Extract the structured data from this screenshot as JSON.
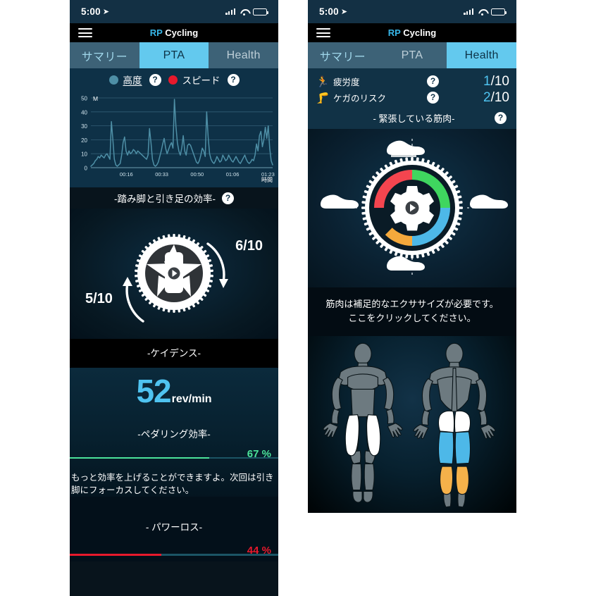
{
  "status_bar": {
    "time": "5:00",
    "location_icon": "location-arrow-icon",
    "signal_icon": "cellular-signal-icon",
    "wifi_icon": "wifi-icon",
    "battery_icon": "battery-icon"
  },
  "nav": {
    "menu_icon": "hamburger-menu-icon",
    "title_brand": "RP",
    "title_rest": " Cycling"
  },
  "tabs": {
    "summary": "サマリー",
    "pta": "PTA",
    "health": "Health"
  },
  "left_screen": {
    "active_tab": "PTA",
    "legend": {
      "altitude_label": "高度",
      "altitude_color": "#4e8fa6",
      "speed_label": "スピード",
      "speed_color": "#e8192c",
      "help_label": "?"
    },
    "efficiency_section": {
      "title": "-踏み脚と引き足の効率-",
      "help_label": "?",
      "right_score": "6/10",
      "left_score": "5/10",
      "chainring_icon": "bicycle-chainring-icon",
      "arrow_down_icon": "curved-arrow-down-icon",
      "arrow_up_icon": "curved-arrow-up-icon"
    },
    "cadence": {
      "title": "-ケイデンス-",
      "value": "52",
      "unit": "rev/min",
      "value_color": "#4fc3f0"
    },
    "pedaling_efficiency": {
      "title": "-ペダリング効率-",
      "percent_text": "67 %",
      "percent": 67,
      "bar_color": "#4be39a",
      "tip": "もっと効率を上げることができますよ。次回は引き脚にフォーカスしてください。"
    },
    "power_loss": {
      "title": "- パワーロス-",
      "percent_text": "44 %",
      "percent": 44,
      "bar_color": "#e8192c"
    }
  },
  "right_screen": {
    "active_tab": "Health",
    "metrics": [
      {
        "icon": "running-person-icon",
        "label": "疲労度",
        "help": "?",
        "score": "1",
        "scale": "/10"
      },
      {
        "icon": "injured-leg-icon",
        "label": "ケガのリスク",
        "help": "?",
        "score": "2",
        "scale": "/10"
      }
    ],
    "tense_muscles": {
      "title": "- 緊張している筋肉-",
      "help_label": "?",
      "gauge_icon": "gear-chainring-gauge-icon",
      "shoe_icon": "cycling-shoe-icon",
      "arc_colors": {
        "top_left": "#f4454f",
        "top_right": "#3fd65f",
        "bottom_right": "#4db8e8",
        "bottom_left": "#f5a93c"
      }
    },
    "advice_line1": "筋肉は補足的なエクササイズが必要です。",
    "advice_line2": "ここをクリックしてください。",
    "body_map": {
      "front_label": "front-body-muscle-map",
      "back_label": "back-body-muscle-map",
      "base_color": "#6d7a80",
      "highlights": [
        {
          "muscle": "quadriceps",
          "view": "front",
          "color": "#ffffff"
        },
        {
          "muscle": "glutes",
          "view": "back",
          "color": "#ffffff"
        },
        {
          "muscle": "hamstrings",
          "view": "back",
          "color": "#4db8e8"
        },
        {
          "muscle": "calves",
          "view": "back",
          "color": "#f5b14a"
        }
      ]
    }
  },
  "chart_data": {
    "type": "line",
    "title": "",
    "xlabel": "時間",
    "ylabel": "M",
    "ylim": [
      0,
      50
    ],
    "yticks": [
      0,
      10,
      20,
      30,
      40,
      50
    ],
    "xticks": [
      "00:16",
      "00:33",
      "00:50",
      "01:06",
      "01:23"
    ],
    "grid": true,
    "line_color": "#4e8fa6",
    "background": "#0e3147",
    "series": [
      {
        "name": "高度",
        "values": [
          1,
          2,
          3,
          5,
          6,
          8,
          7,
          9,
          8,
          7,
          9,
          10,
          8,
          6,
          33,
          20,
          6,
          2,
          1,
          2,
          3,
          9,
          18,
          22,
          12,
          9,
          12,
          10,
          11,
          13,
          12,
          10,
          12,
          11,
          10,
          9,
          8,
          7,
          6,
          9,
          28,
          18,
          6,
          2,
          1,
          2,
          4,
          8,
          12,
          17,
          21,
          14,
          10,
          13,
          16,
          18,
          14,
          49,
          30,
          18,
          12,
          9,
          14,
          23,
          12,
          9,
          16,
          17,
          16,
          13,
          10,
          7,
          4,
          3,
          5,
          9,
          14,
          12,
          8,
          40,
          22,
          10,
          6,
          4,
          3,
          5,
          8,
          6,
          4,
          5,
          9,
          7,
          5,
          6,
          9,
          7,
          5,
          4,
          6,
          8,
          6,
          4,
          3,
          5,
          7,
          9,
          6,
          4,
          3,
          4,
          6,
          5,
          9,
          17,
          12,
          23,
          26,
          15,
          20,
          29,
          21,
          30,
          14,
          5,
          2
        ]
      }
    ]
  }
}
